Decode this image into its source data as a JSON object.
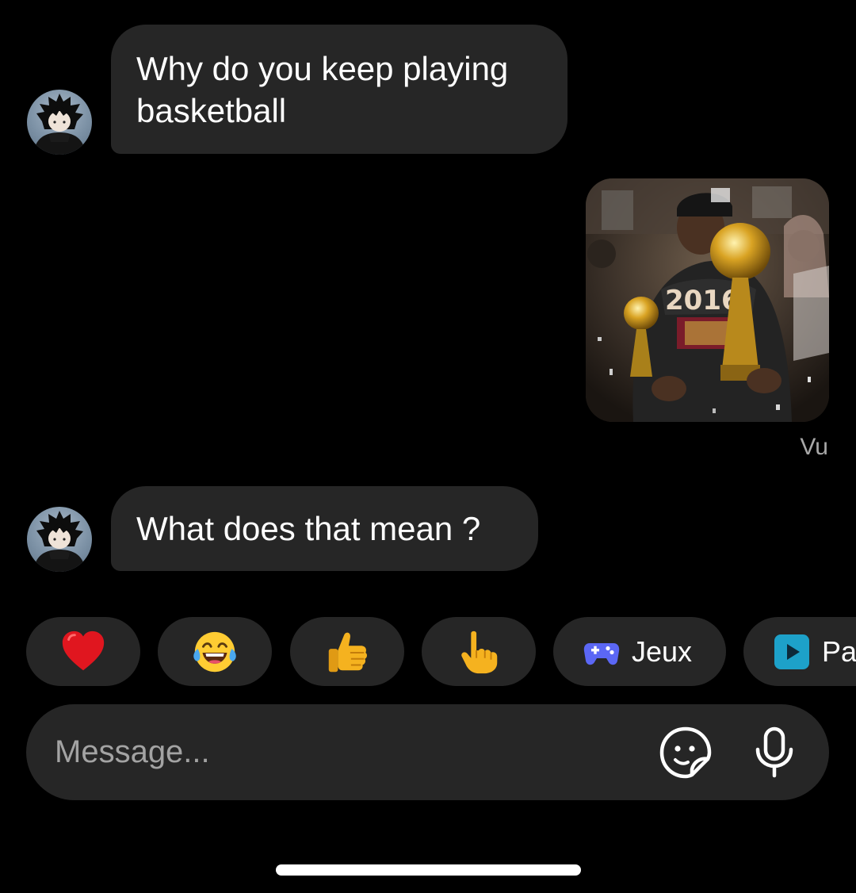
{
  "thread": {
    "messages": [
      {
        "from": "contact",
        "type": "text",
        "text": "Why do you keep playing basketball"
      },
      {
        "from": "me",
        "type": "image",
        "image_icon": "championship-photo"
      },
      {
        "from": "contact",
        "type": "text",
        "text": "What does that mean ?"
      }
    ],
    "seen_label": "Vu"
  },
  "quick_reactions": [
    {
      "icon": "red-heart-emoji"
    },
    {
      "icon": "tears-of-joy-emoji"
    },
    {
      "icon": "thumbs-up-emoji"
    },
    {
      "icon": "pointing-hand-emoji"
    }
  ],
  "quick_actions": [
    {
      "icon": "game-controller-icon",
      "label": "Jeux",
      "color": "#5b67f5"
    },
    {
      "icon": "play-icon",
      "label": "Pa",
      "color": "#1da1c9"
    }
  ],
  "composer": {
    "placeholder": "Message...",
    "sticker_icon": "sticker-icon",
    "mic_icon": "microphone-icon"
  },
  "colors": {
    "background": "#000000",
    "bubble": "#262626",
    "muted_text": "#a8a8a8"
  }
}
